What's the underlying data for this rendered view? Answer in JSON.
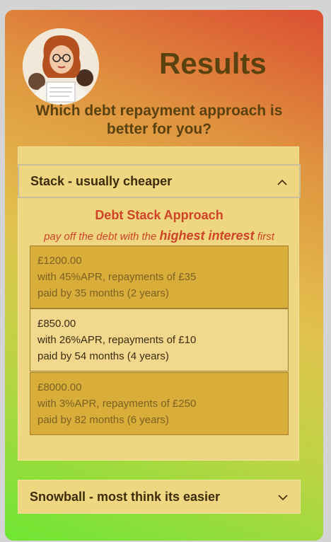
{
  "header": {
    "title": "Results",
    "question": "Which debt repayment approach is better for you?"
  },
  "accordion": [
    {
      "label": "Stack - usually cheaper",
      "expanded": true
    },
    {
      "label": "Snowball - most think its easier",
      "expanded": false
    }
  ],
  "stack": {
    "title": "Debt Stack Approach",
    "desc_before": "pay off the debt with the ",
    "desc_emphasis": "highest interest",
    "desc_after": " first",
    "debts": [
      {
        "amount": "£1200.00",
        "terms": "with 45%APR, repayments of £35",
        "payoff": "paid by 35 months (2 years)"
      },
      {
        "amount": "£850.00",
        "terms": "with 26%APR, repayments of £10",
        "payoff": "paid by 54 months (4 years)"
      },
      {
        "amount": "£8000.00",
        "terms": "with 3%APR, repayments of £250",
        "payoff": "paid by 82 months (6 years)"
      }
    ]
  },
  "colors": {
    "accent": "#cf4328",
    "panel": "#efd782",
    "title_text": "#5a4210"
  }
}
